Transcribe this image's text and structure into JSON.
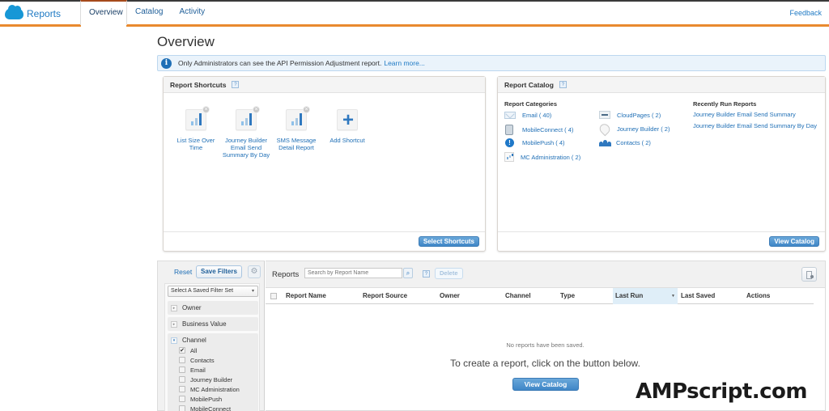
{
  "app": {
    "title": "Reports",
    "tabs": [
      {
        "label": "Overview",
        "active": true
      },
      {
        "label": "Catalog",
        "active": false
      },
      {
        "label": "Activity",
        "active": false
      }
    ],
    "feedback_label": "Feedback"
  },
  "page": {
    "title": "Overview",
    "banner": {
      "icon": "info-icon",
      "text": "Only Administrators can see the API Permission Adjustment report.",
      "link": "Learn more..."
    }
  },
  "shortcuts_panel": {
    "title": "Report Shortcuts",
    "help": "?",
    "items": [
      {
        "label": "List Size Over Time",
        "icon": "bar-chart-icon",
        "removable": true
      },
      {
        "label": "Journey Builder Email Send Summary By Day",
        "icon": "bar-chart-icon",
        "removable": true
      },
      {
        "label": "SMS Message Detail Report",
        "icon": "bar-chart-icon",
        "removable": true
      },
      {
        "label": "Add Shortcut",
        "icon": "plus-icon",
        "removable": false
      }
    ],
    "remove_glyph": "×",
    "add_glyph": "+",
    "button_label": "Select Shortcuts"
  },
  "catalog_panel": {
    "title": "Report Catalog",
    "help": "?",
    "categories_heading": "Report Categories",
    "categories": [
      {
        "label": "Email ( 40)",
        "icon": "envelope-icon"
      },
      {
        "label": "MobileConnect ( 4)",
        "icon": "mobile-phone-icon"
      },
      {
        "label": "MobilePush ( 4)",
        "icon": "push-notification-icon"
      },
      {
        "label": "MC Administration ( 2)",
        "icon": "admin-chart-icon"
      },
      {
        "label": "CloudPages ( 2)",
        "icon": "web-page-icon"
      },
      {
        "label": "Journey Builder ( 2)",
        "icon": "map-pin-icon"
      },
      {
        "label": "Contacts ( 2)",
        "icon": "people-icon"
      }
    ],
    "recent_heading": "Recently Run Reports",
    "recent": [
      "Journey Builder Email Send Summary",
      "Journey Builder Email Send Summary By Day"
    ],
    "button_label": "View Catalog"
  },
  "filters": {
    "reset_label": "Reset",
    "save_label": "Save Filters",
    "gear_glyph": "⚙",
    "saved_set_placeholder": "Select A Saved Filter Set",
    "caret": "▾",
    "facets": [
      {
        "label": "Owner",
        "expanded": false
      },
      {
        "label": "Business Value",
        "expanded": false
      },
      {
        "label": "Channel",
        "expanded": true
      }
    ],
    "collapsed_glyph": "▸",
    "expanded_glyph": "▾",
    "channel_options": [
      {
        "label": "All",
        "checked": true
      },
      {
        "label": "Contacts",
        "checked": false
      },
      {
        "label": "Email",
        "checked": false
      },
      {
        "label": "Journey Builder",
        "checked": false
      },
      {
        "label": "MC Administration",
        "checked": false
      },
      {
        "label": "MobilePush",
        "checked": false
      },
      {
        "label": "MobileConnect",
        "checked": false
      }
    ],
    "check_glyph": "✔"
  },
  "reports": {
    "label": "Reports",
    "search_placeholder": "Search by Report Name",
    "search_glyph": "⌕",
    "help": "?",
    "delete_label": "Delete",
    "columns": [
      "Report Name",
      "Report Source",
      "Owner",
      "Channel",
      "Type",
      "Last Run",
      "Last Saved",
      "Actions"
    ],
    "sorted_column": "Last Run",
    "sort_glyph": "▼",
    "empty_message": "No reports have been saved.",
    "empty_hint": "To create a report, click on the button below.",
    "empty_button_label": "View Catalog"
  },
  "watermark": "AMPscript.com",
  "colors": {
    "accent_orange": "#e98a2e",
    "link_blue": "#1f7ac4",
    "button_blue": "#4a8fcc",
    "banner_bg": "#eaf3fb"
  }
}
